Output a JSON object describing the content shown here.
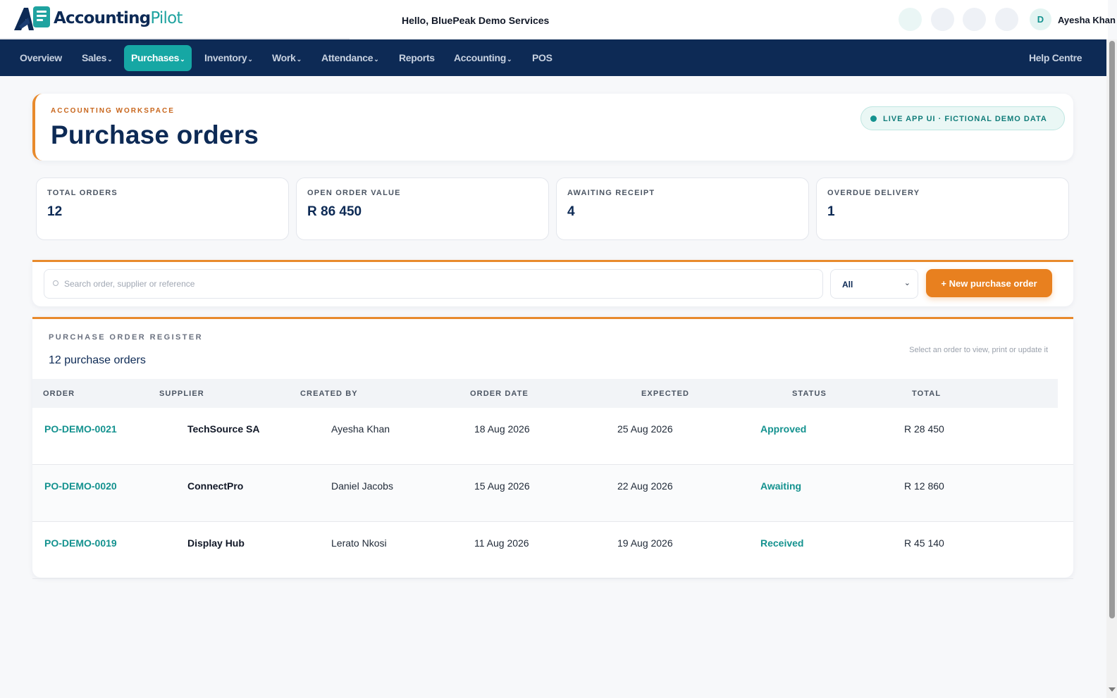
{
  "brand": {
    "name_main": "Accounting",
    "name_accent": "Pilot"
  },
  "header": {
    "greeting": "Hello, BluePeak Demo Services",
    "user_initial": "D",
    "user_name": "Ayesha Khan"
  },
  "nav": {
    "items": [
      {
        "label": "Overview",
        "caret": ""
      },
      {
        "label": "Sales",
        "caret": "⌄"
      },
      {
        "label": "Purchases",
        "caret": "⌄"
      },
      {
        "label": "Inventory",
        "caret": "⌄"
      },
      {
        "label": "Work",
        "caret": "⌄"
      },
      {
        "label": "Attendance",
        "caret": "⌄"
      },
      {
        "label": "Reports",
        "caret": ""
      },
      {
        "label": "Accounting",
        "caret": "⌄"
      },
      {
        "label": "POS",
        "caret": ""
      }
    ],
    "active": "Purchases",
    "help": "Help Centre"
  },
  "page": {
    "eyebrow": "ACCOUNTING WORKSPACE",
    "title": "Purchase orders",
    "badge": "LIVE APP UI · FICTIONAL DEMO DATA"
  },
  "stats": [
    {
      "label": "TOTAL ORDERS",
      "value": "12"
    },
    {
      "label": "OPEN ORDER VALUE",
      "value": "R 86 450"
    },
    {
      "label": "AWAITING RECEIPT",
      "value": "4"
    },
    {
      "label": "OVERDUE DELIVERY",
      "value": "1"
    }
  ],
  "toolbar": {
    "search_placeholder": "Search order, supplier or reference",
    "filter_value": "All",
    "new_button": "+ New purchase order"
  },
  "register": {
    "title": "PURCHASE ORDER REGISTER",
    "count": "12 purchase orders",
    "hint": "Select an order to view, print or update it",
    "columns": [
      "ORDER",
      "SUPPLIER",
      "CREATED BY",
      "ORDER DATE",
      "EXPECTED",
      "STATUS",
      "TOTAL"
    ],
    "rows": [
      {
        "order": "PO-DEMO-0021",
        "supplier": "TechSource SA",
        "created_by": "Ayesha Khan",
        "order_date": "18 Aug 2026",
        "expected": "25 Aug 2026",
        "status": "Approved",
        "total": "R 28 450"
      },
      {
        "order": "PO-DEMO-0020",
        "supplier": "ConnectPro",
        "created_by": "Daniel Jacobs",
        "order_date": "15 Aug 2026",
        "expected": "22 Aug 2026",
        "status": "Awaiting",
        "total": "R 12 860"
      },
      {
        "order": "PO-DEMO-0019",
        "supplier": "Display Hub",
        "created_by": "Lerato Nkosi",
        "order_date": "11 Aug 2026",
        "expected": "19 Aug 2026",
        "status": "Received",
        "total": "R 45 140"
      }
    ]
  },
  "colors": {
    "navy": "#0d2a55",
    "teal": "#16a7a4",
    "orange": "#e8801f"
  }
}
